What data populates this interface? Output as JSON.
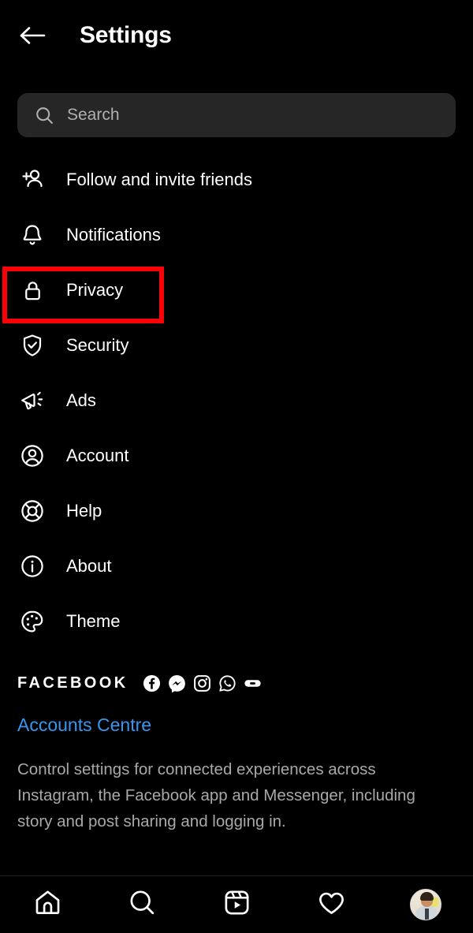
{
  "header": {
    "back_icon": "back-arrow-icon",
    "title": "Settings"
  },
  "search": {
    "icon": "search-icon",
    "placeholder": "Search",
    "value": ""
  },
  "settings": {
    "items": [
      {
        "icon": "person-add-icon",
        "label": "Follow and invite friends",
        "highlighted": false
      },
      {
        "icon": "bell-icon",
        "label": "Notifications",
        "highlighted": false
      },
      {
        "icon": "lock-icon",
        "label": "Privacy",
        "highlighted": true
      },
      {
        "icon": "shield-check-icon",
        "label": "Security",
        "highlighted": false
      },
      {
        "icon": "megaphone-icon",
        "label": "Ads",
        "highlighted": false
      },
      {
        "icon": "account-circle-icon",
        "label": "Account",
        "highlighted": false
      },
      {
        "icon": "life-ring-icon",
        "label": "Help",
        "highlighted": false
      },
      {
        "icon": "info-circle-icon",
        "label": "About",
        "highlighted": false
      },
      {
        "icon": "palette-icon",
        "label": "Theme",
        "highlighted": false
      }
    ]
  },
  "facebook_section": {
    "heading": "FACEBOOK",
    "app_icons": [
      {
        "name": "facebook-icon"
      },
      {
        "name": "messenger-icon"
      },
      {
        "name": "instagram-icon"
      },
      {
        "name": "whatsapp-icon"
      },
      {
        "name": "oculus-icon"
      }
    ],
    "link_label": "Accounts Centre",
    "description": "Control settings for connected experiences across Instagram, the Facebook app and Messenger, including story and post sharing and logging in."
  },
  "bottom_nav": {
    "items": [
      {
        "icon": "home-icon",
        "name": "nav-home"
      },
      {
        "icon": "search-icon",
        "name": "nav-search"
      },
      {
        "icon": "reels-icon",
        "name": "nav-reels"
      },
      {
        "icon": "heart-icon",
        "name": "nav-activity"
      },
      {
        "icon": "avatar",
        "name": "nav-profile"
      }
    ]
  },
  "colors": {
    "background": "#000000",
    "text": "#ffffff",
    "muted_text": "#a8a8a8",
    "search_field": "#262626",
    "link_blue": "#3797f0",
    "highlight_red": "#fb0007"
  }
}
